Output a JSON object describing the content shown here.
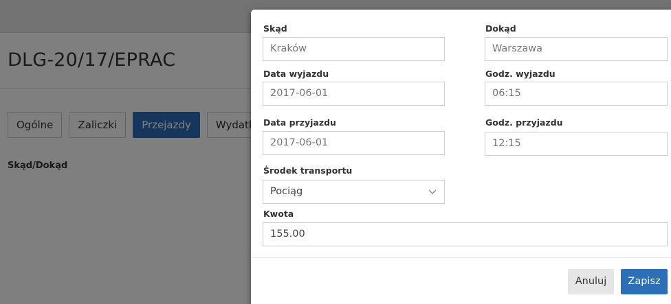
{
  "background": {
    "document_title": "DLG-20/17/EPRAC",
    "tabs": [
      {
        "label": "Ogólne",
        "active": false
      },
      {
        "label": "Zaliczki",
        "active": false
      },
      {
        "label": "Przejazdy",
        "active": true
      },
      {
        "label": "Wydatki",
        "active": false
      }
    ],
    "table_header": "Skąd/Dokąd"
  },
  "modal": {
    "from": {
      "label": "Skąd",
      "placeholder": "Kraków"
    },
    "to": {
      "label": "Dokąd",
      "placeholder": "Warszawa"
    },
    "departure_date": {
      "label": "Data wyjazdu",
      "value": "2017-06-01"
    },
    "departure_time": {
      "label": "Godz. wyjazdu",
      "value": "06:15"
    },
    "arrival_date": {
      "label": "Data przyjazdu",
      "value": "2017-06-01"
    },
    "arrival_time": {
      "label": "Godz. przyjazdu",
      "value": "12:15"
    },
    "transport": {
      "label": "Środek transportu",
      "value": "Pociąg"
    },
    "amount": {
      "label": "Kwota",
      "value": "155.00"
    },
    "buttons": {
      "cancel": "Anuluj",
      "save": "Zapisz"
    }
  },
  "colors": {
    "primary": "#2c6fb6",
    "overlay": "rgba(0,0,0,0.5)"
  }
}
